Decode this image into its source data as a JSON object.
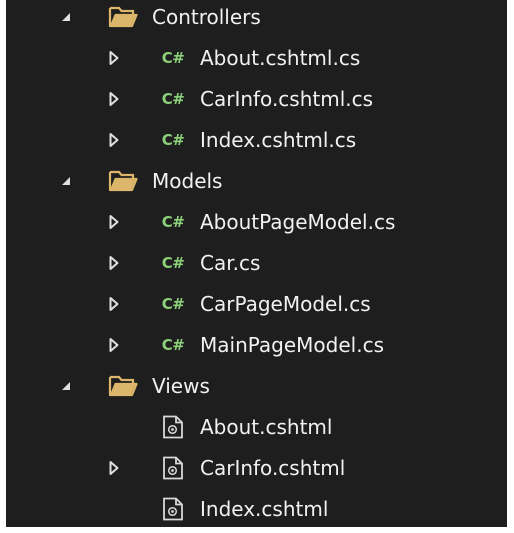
{
  "colors": {
    "background": "#1e1e1e",
    "text": "#f1f1f1",
    "folder": "#dcb66a",
    "csharp": "#8cd17a",
    "expander": "#e0e0e0"
  },
  "tree": [
    {
      "label": "Controllers",
      "icon": "folder-open-icon",
      "expanded": true,
      "children": [
        {
          "label": "About.cshtml.cs",
          "icon": "csharp-file-icon",
          "badge": "C#",
          "expandable": true,
          "expanded": false
        },
        {
          "label": "CarInfo.cshtml.cs",
          "icon": "csharp-file-icon",
          "badge": "C#",
          "expandable": true,
          "expanded": false
        },
        {
          "label": "Index.cshtml.cs",
          "icon": "csharp-file-icon",
          "badge": "C#",
          "expandable": true,
          "expanded": false
        }
      ]
    },
    {
      "label": "Models",
      "icon": "folder-open-icon",
      "expanded": true,
      "children": [
        {
          "label": "AboutPageModel.cs",
          "icon": "csharp-file-icon",
          "badge": "C#",
          "expandable": true,
          "expanded": false
        },
        {
          "label": "Car.cs",
          "icon": "csharp-file-icon",
          "badge": "C#",
          "expandable": true,
          "expanded": false
        },
        {
          "label": "CarPageModel.cs",
          "icon": "csharp-file-icon",
          "badge": "C#",
          "expandable": true,
          "expanded": false
        },
        {
          "label": "MainPageModel.cs",
          "icon": "csharp-file-icon",
          "badge": "C#",
          "expandable": true,
          "expanded": false
        }
      ]
    },
    {
      "label": "Views",
      "icon": "folder-open-icon",
      "expanded": true,
      "children": [
        {
          "label": "About.cshtml",
          "icon": "razor-file-icon",
          "expandable": false
        },
        {
          "label": "CarInfo.cshtml",
          "icon": "razor-file-icon",
          "expandable": true,
          "expanded": false
        },
        {
          "label": "Index.cshtml",
          "icon": "razor-file-icon",
          "expandable": false
        }
      ]
    }
  ]
}
